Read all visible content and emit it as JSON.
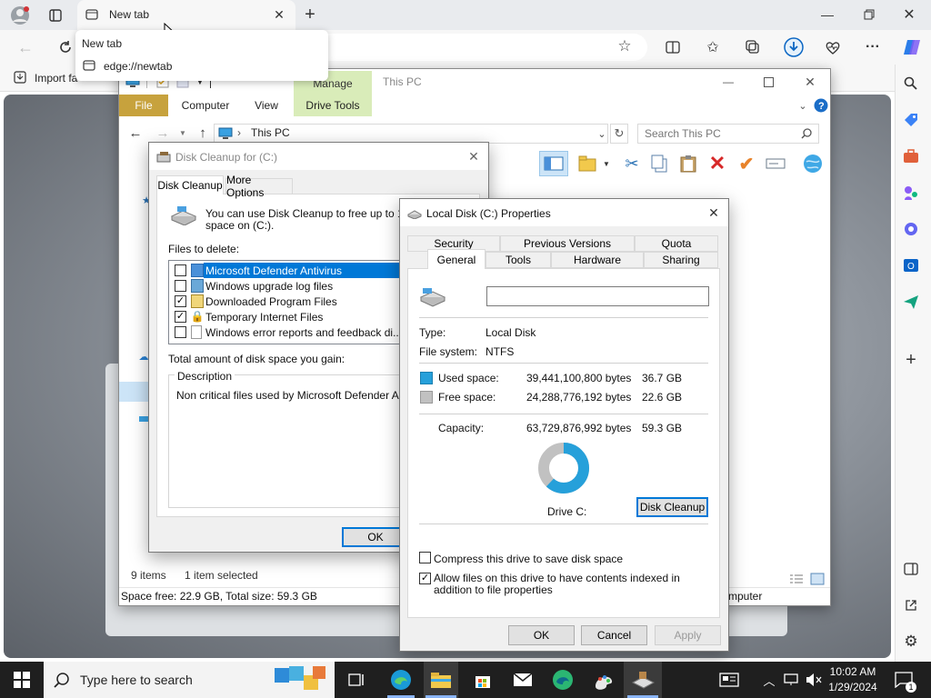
{
  "browser": {
    "tab_title": "New tab",
    "tab_hover_title": "New tab",
    "tab_hover_url": "edge://newtab",
    "favorites_import": "Import fa"
  },
  "explorer": {
    "title": "This PC",
    "ribbon_tabs": [
      "File",
      "Computer",
      "View",
      "Drive Tools"
    ],
    "manage_label": "Manage",
    "breadcrumb": "This PC",
    "search_placeholder": "Search This PC",
    "status_items": "9 items",
    "status_selected": "1 item selected",
    "status_space": "Space free: 22.9 GB, Total size: 59.3 GB",
    "status_computer": "mputer"
  },
  "cleanup": {
    "title": "Disk Cleanup for  (C:)",
    "tabs": [
      "Disk Cleanup",
      "More Options"
    ],
    "intro_line1": "You can use Disk Cleanup to free up to 18.0",
    "intro_line2": "space on  (C:).",
    "files_label": "Files to delete:",
    "files": [
      {
        "name": "Microsoft Defender Antivirus",
        "checked": false
      },
      {
        "name": "Windows upgrade log files",
        "checked": false
      },
      {
        "name": "Downloaded Program Files",
        "checked": true
      },
      {
        "name": "Temporary Internet Files",
        "checked": true
      },
      {
        "name": "Windows error reports and feedback di...",
        "checked": false
      }
    ],
    "total_label": "Total amount of disk space you gain:",
    "description_label": "Description",
    "description_text": "Non critical files used by Microsoft Defender Antivirus",
    "ok": "OK"
  },
  "props": {
    "title": "Local Disk (C:) Properties",
    "tabs_row1": [
      "Security",
      "Previous Versions",
      "Quota"
    ],
    "tabs_row2": [
      "General",
      "Tools",
      "Hardware",
      "Sharing"
    ],
    "type_label": "Type:",
    "type_value": "Local Disk",
    "fs_label": "File system:",
    "fs_value": "NTFS",
    "used_label": "Used space:",
    "used_bytes": "39,441,100,800 bytes",
    "used_gb": "36.7 GB",
    "free_label": "Free space:",
    "free_bytes": "24,288,776,192 bytes",
    "free_gb": "22.6 GB",
    "cap_label": "Capacity:",
    "cap_bytes": "63,729,876,992 bytes",
    "cap_gb": "59.3 GB",
    "used_fraction": 0.619,
    "drive_label": "Drive C:",
    "cleanup_button": "Disk Cleanup",
    "compress_label": "Compress this drive to save disk space",
    "compress_checked": false,
    "index_label": "Allow files on this drive to have contents indexed in addition to file properties",
    "index_checked": true,
    "ok": "OK",
    "cancel": "Cancel",
    "apply": "Apply",
    "used_color": "#26a0da",
    "free_color": "#c1c1c1"
  },
  "taskbar": {
    "search_placeholder": "Type here to search",
    "time": "10:02 AM",
    "date": "1/29/2024",
    "notification_count": "1"
  }
}
